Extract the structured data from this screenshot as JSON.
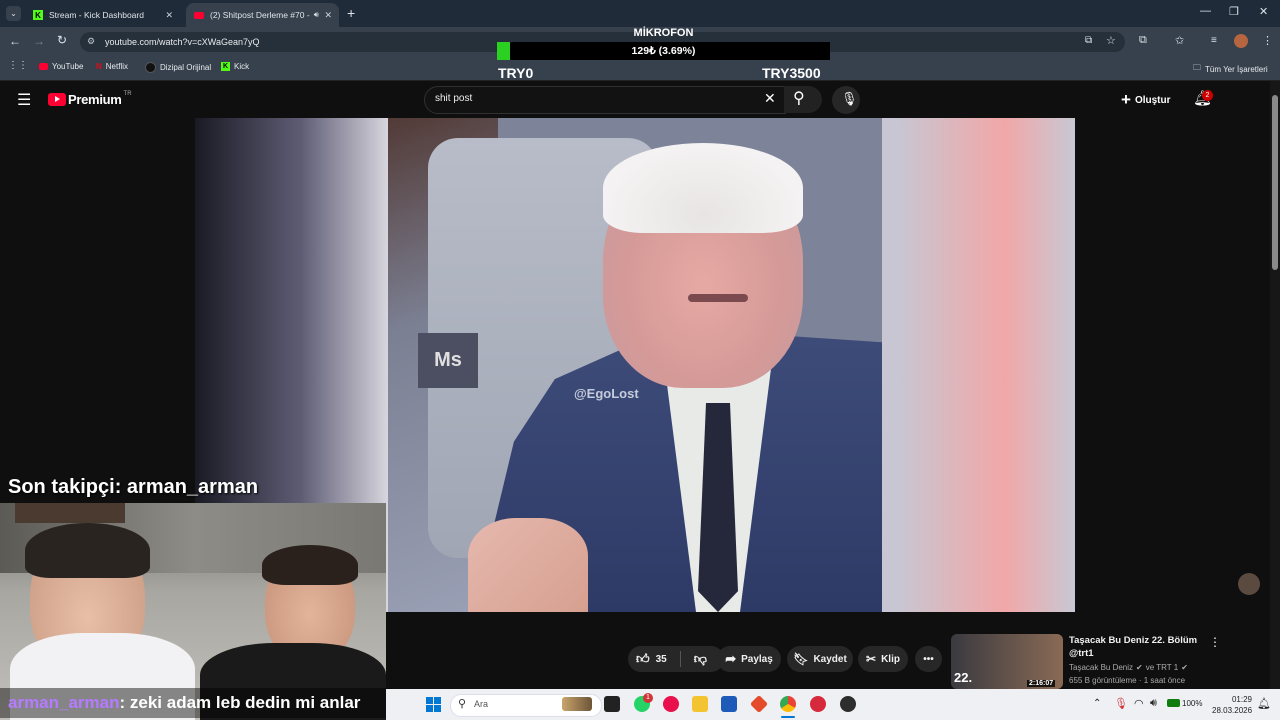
{
  "browser": {
    "tabs": [
      {
        "label": "Stream - Kick Dashboard",
        "favicon": "kick-icon",
        "active": false
      },
      {
        "label": "(2) Shitpost Derleme #70 - ",
        "favicon": "youtube-icon",
        "active": true
      }
    ],
    "url": "youtube.com/watch?v=cXWaGean7yQ",
    "bookmarks": [
      "YouTube",
      "Netflix",
      "Dizipal Orijinal",
      "Kick"
    ],
    "all_bookmarks_label": "Tüm Yer İşaretleri"
  },
  "mic_overlay": {
    "title": "MİKROFON",
    "value_text": "129₺ (3.69%)",
    "progress_fraction": 0.0369,
    "min_label": "TRY0",
    "max_label": "TRY3500",
    "fill_color": "#2bd120"
  },
  "youtube": {
    "logo_text": "Premium",
    "country": "TR",
    "search_query": "shit post",
    "create_label": "Oluştur",
    "notification_count": "2",
    "watermark": "@EgoLost",
    "like_count": "35",
    "share_label": "Paylaş",
    "save_label": "Kaydet",
    "clip_label": "Klip",
    "recommendation": {
      "title": "Taşacak Bu Deniz 22. Bölüm @trt1",
      "channel": "Taşacak Bu Deniz",
      "channel2": "ve TRT 1",
      "meta": "655 B görüntüleme · 1 saat önce",
      "duration": "2:16:07",
      "thumb_text": "22."
    },
    "accent_color": "#ff0033"
  },
  "stream_overlay": {
    "last_follower": "Son takipçi: arman_arman",
    "chat_user": "arman_arman",
    "chat_message": ": zeki adam leb dedin mi anlar",
    "chat_user_color": "#b57bff"
  },
  "taskbar": {
    "search_placeholder": "Ara",
    "whatsapp_badge": "1",
    "battery": "100%",
    "time": "01:29",
    "date": "28.03.2026"
  }
}
